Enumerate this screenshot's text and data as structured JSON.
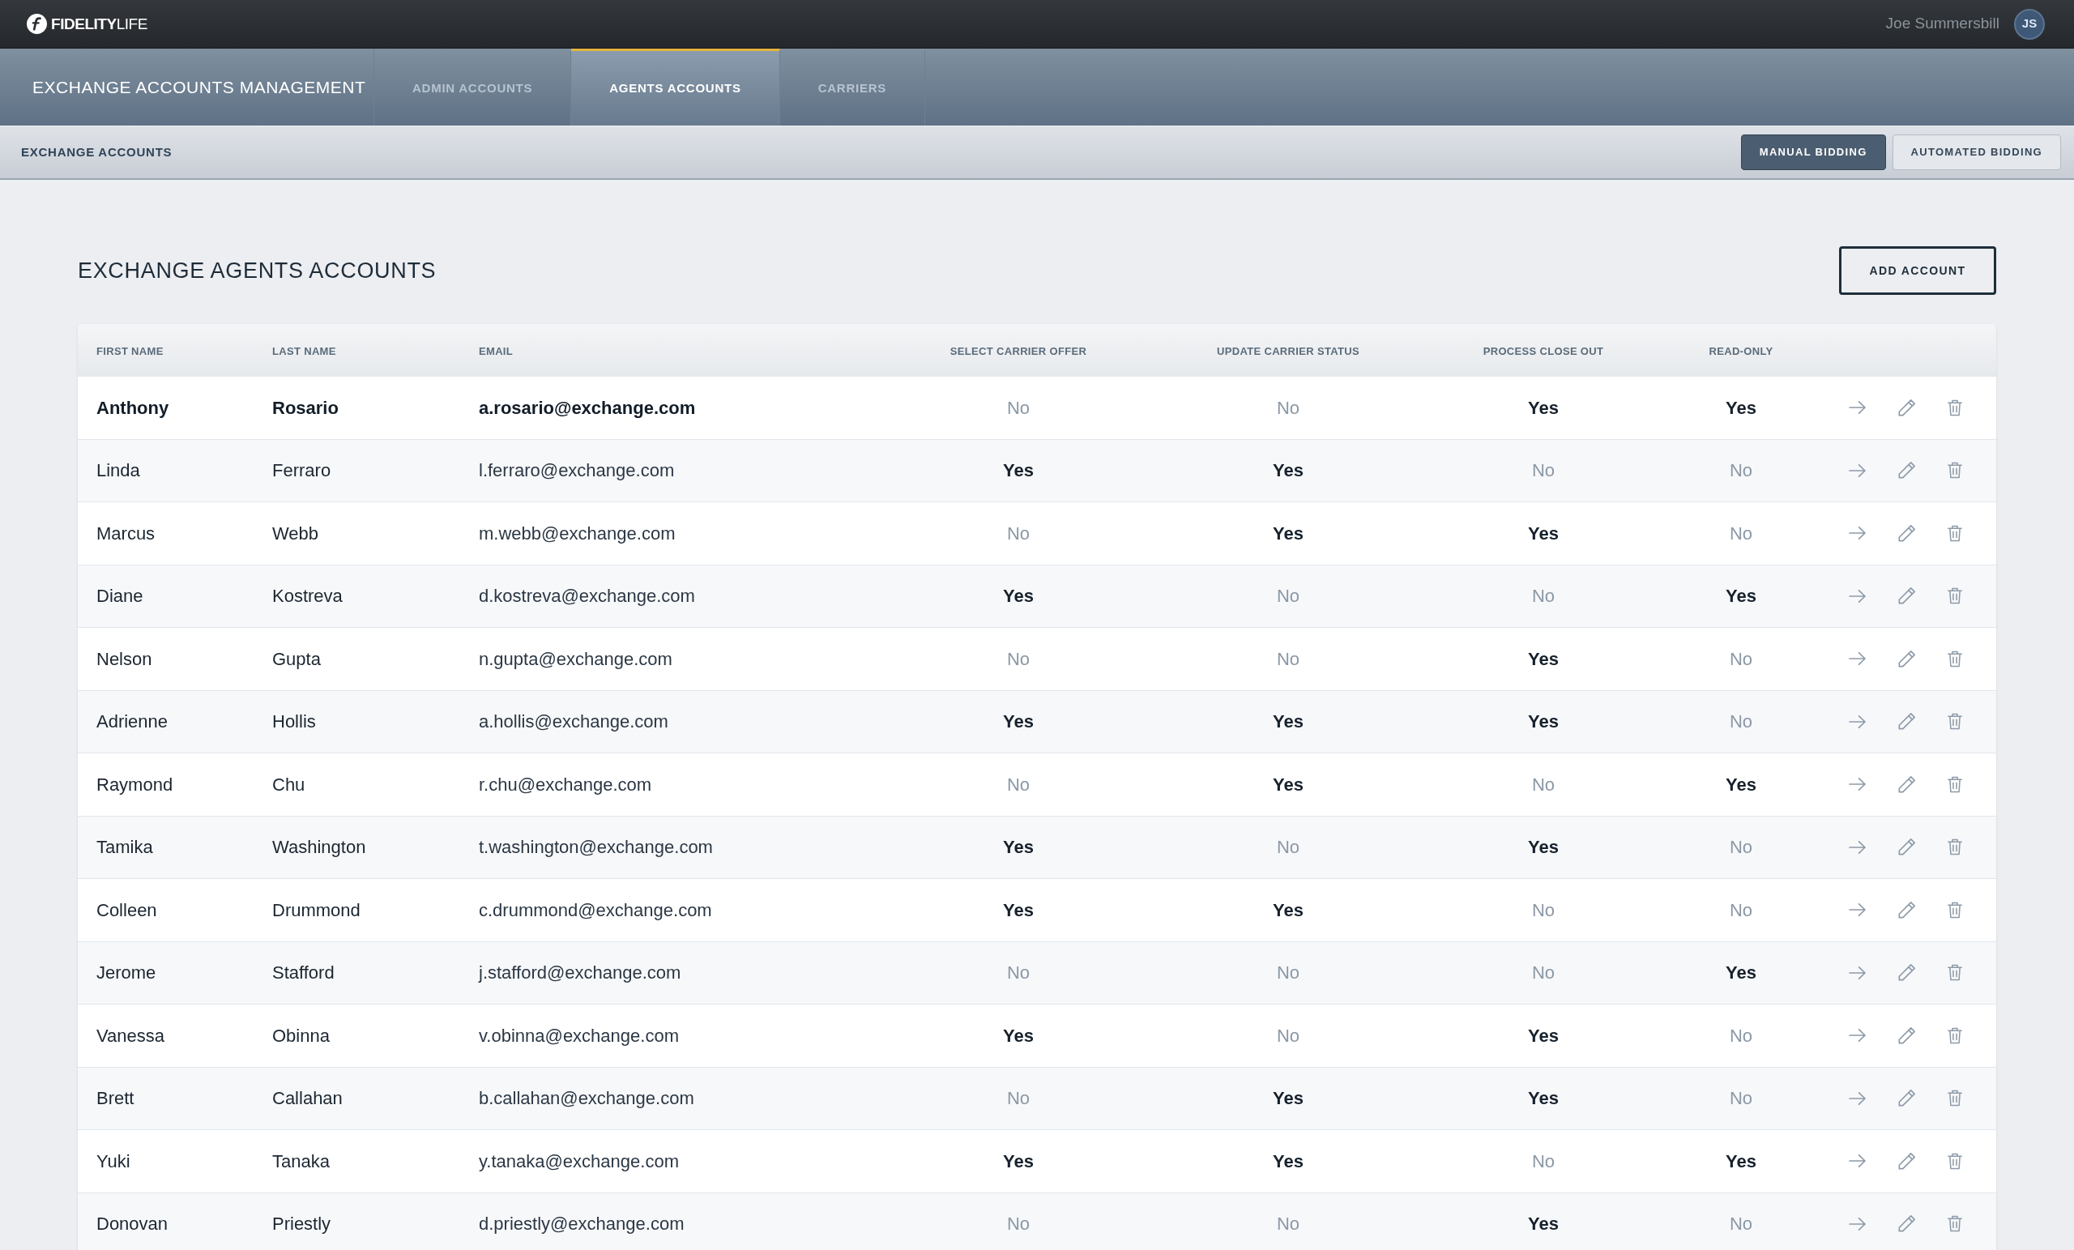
{
  "top_bar": {
    "logo_text": "**FIDELITY**LIFE",
    "user_name": "Joe Summersbill",
    "avatar_initials": "JS"
  },
  "nav": {
    "title": "EXCHANGE ACCOUNTS MANAGEMENT",
    "tabs": [
      {
        "label": "ADMIN ACCOUNTS",
        "selected": false
      },
      {
        "label": "AGENTS ACCOUNTS",
        "selected": true
      },
      {
        "label": "CARRIERS",
        "selected": false
      }
    ]
  },
  "sub_bar": {
    "title": "EXCHANGE ACCOUNTS",
    "bidding_modes": [
      {
        "label": "MANUAL BIDDING",
        "selected": true
      },
      {
        "label": "AUTOMATED BIDDING",
        "selected": false
      }
    ]
  },
  "page": {
    "title": "EXCHANGE AGENTS ACCOUNTS",
    "add_button": "ADD ACCOUNT"
  },
  "table": {
    "columns": [
      "FIRST NAME",
      "LAST NAME",
      "EMAIL",
      "SELECT CARRIER OFFER",
      "UPDATE CARRIER STATUS",
      "PROCESS CLOSE OUT",
      "READ-ONLY"
    ],
    "rows": [
      {
        "first_name": "Anthony",
        "last_name": "Rosario",
        "email": "a.rosario@exchange.com",
        "emphasized": true,
        "flags": [
          {
            "text": "No",
            "on": false
          },
          {
            "text": "No",
            "on": false
          },
          {
            "text": "Yes",
            "on": true
          },
          {
            "text": "Yes",
            "on": true
          }
        ]
      },
      {
        "first_name": "Linda",
        "last_name": "Ferraro",
        "email": "l.ferraro@exchange.com",
        "emphasized": false,
        "flags": [
          {
            "text": "Yes",
            "on": true
          },
          {
            "text": "Yes",
            "on": true
          },
          {
            "text": "No",
            "on": false
          },
          {
            "text": "No",
            "on": false
          }
        ]
      },
      {
        "first_name": "Marcus",
        "last_name": "Webb",
        "email": "m.webb@exchange.com",
        "emphasized": false,
        "flags": [
          {
            "text": "No",
            "on": false
          },
          {
            "text": "Yes",
            "on": true
          },
          {
            "text": "Yes",
            "on": true
          },
          {
            "text": "No",
            "on": false
          }
        ]
      },
      {
        "first_name": "Diane",
        "last_name": "Kostreva",
        "email": "d.kostreva@exchange.com",
        "emphasized": false,
        "flags": [
          {
            "text": "Yes",
            "on": true
          },
          {
            "text": "No",
            "on": false
          },
          {
            "text": "No",
            "on": false
          },
          {
            "text": "Yes",
            "on": true
          }
        ]
      },
      {
        "first_name": "Nelson",
        "last_name": "Gupta",
        "email": "n.gupta@exchange.com",
        "emphasized": false,
        "flags": [
          {
            "text": "No",
            "on": false
          },
          {
            "text": "No",
            "on": false
          },
          {
            "text": "Yes",
            "on": true
          },
          {
            "text": "No",
            "on": false
          }
        ]
      },
      {
        "first_name": "Adrienne",
        "last_name": "Hollis",
        "email": "a.hollis@exchange.com",
        "emphasized": false,
        "flags": [
          {
            "text": "Yes",
            "on": true
          },
          {
            "text": "Yes",
            "on": true
          },
          {
            "text": "Yes",
            "on": true
          },
          {
            "text": "No",
            "on": false
          }
        ]
      },
      {
        "first_name": "Raymond",
        "last_name": "Chu",
        "email": "r.chu@exchange.com",
        "emphasized": false,
        "flags": [
          {
            "text": "No",
            "on": false
          },
          {
            "text": "Yes",
            "on": true
          },
          {
            "text": "No",
            "on": false
          },
          {
            "text": "Yes",
            "on": true
          }
        ]
      },
      {
        "first_name": "Tamika",
        "last_name": "Washington",
        "email": "t.washington@exchange.com",
        "emphasized": false,
        "flags": [
          {
            "text": "Yes",
            "on": true
          },
          {
            "text": "No",
            "on": false
          },
          {
            "text": "Yes",
            "on": true
          },
          {
            "text": "No",
            "on": false
          }
        ]
      },
      {
        "first_name": "Colleen",
        "last_name": "Drummond",
        "email": "c.drummond@exchange.com",
        "emphasized": false,
        "flags": [
          {
            "text": "Yes",
            "on": true
          },
          {
            "text": "Yes",
            "on": true
          },
          {
            "text": "No",
            "on": false
          },
          {
            "text": "No",
            "on": false
          }
        ]
      },
      {
        "first_name": "Jerome",
        "last_name": "Stafford",
        "email": "j.stafford@exchange.com",
        "emphasized": false,
        "flags": [
          {
            "text": "No",
            "on": false
          },
          {
            "text": "No",
            "on": false
          },
          {
            "text": "No",
            "on": false
          },
          {
            "text": "Yes",
            "on": true
          }
        ]
      },
      {
        "first_name": "Vanessa",
        "last_name": "Obinna",
        "email": "v.obinna@exchange.com",
        "emphasized": false,
        "flags": [
          {
            "text": "Yes",
            "on": true
          },
          {
            "text": "No",
            "on": false
          },
          {
            "text": "Yes",
            "on": true
          },
          {
            "text": "No",
            "on": false
          }
        ]
      },
      {
        "first_name": "Brett",
        "last_name": "Callahan",
        "email": "b.callahan@exchange.com",
        "emphasized": false,
        "flags": [
          {
            "text": "No",
            "on": false
          },
          {
            "text": "Yes",
            "on": true
          },
          {
            "text": "Yes",
            "on": true
          },
          {
            "text": "No",
            "on": false
          }
        ]
      },
      {
        "first_name": "Yuki",
        "last_name": "Tanaka",
        "email": "y.tanaka@exchange.com",
        "emphasized": false,
        "flags": [
          {
            "text": "Yes",
            "on": true
          },
          {
            "text": "Yes",
            "on": true
          },
          {
            "text": "No",
            "on": false
          },
          {
            "text": "Yes",
            "on": true
          }
        ]
      },
      {
        "first_name": "Donovan",
        "last_name": "Priestly",
        "email": "d.priestly@exchange.com",
        "emphasized": false,
        "flags": [
          {
            "text": "No",
            "on": false
          },
          {
            "text": "No",
            "on": false
          },
          {
            "text": "Yes",
            "on": true
          },
          {
            "text": "No",
            "on": false
          }
        ]
      }
    ]
  }
}
